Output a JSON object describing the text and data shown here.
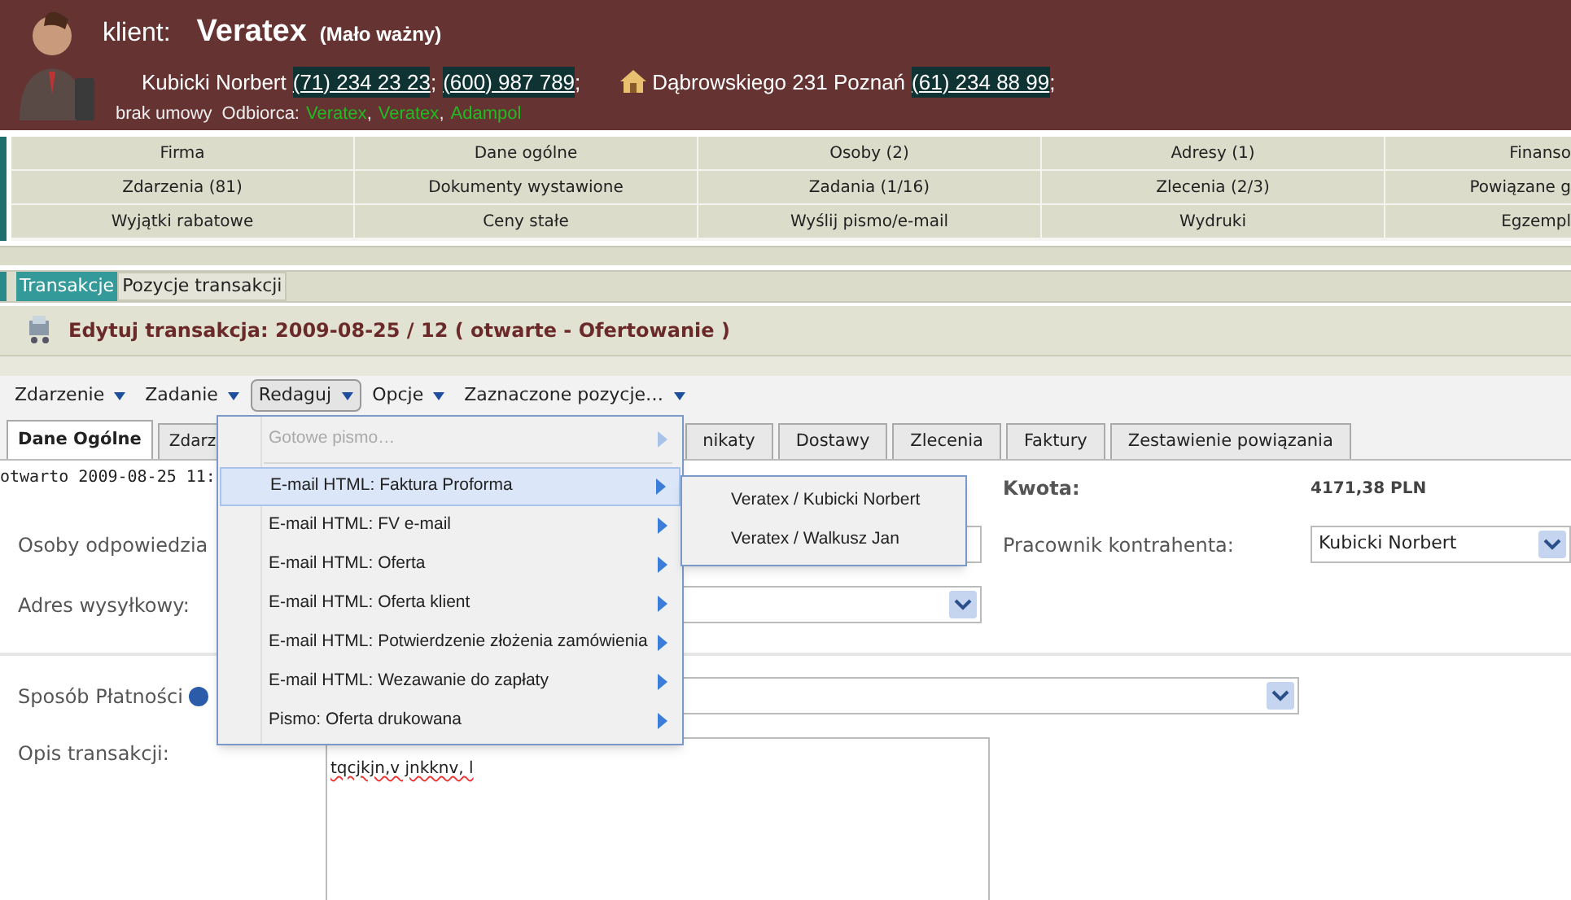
{
  "header": {
    "label": "klient:",
    "name": "Veratex",
    "priority": "(Mało ważny)",
    "person": "Kubicki Norbert",
    "phones": [
      "(71) 234 23 23",
      "(600) 987 789"
    ],
    "address": "Dąbrowskiego 231 Poznań",
    "address_phone": "(61) 234 88 99",
    "contract": "brak umowy",
    "recipient_label": "Odbiorca:",
    "recipients": [
      "Veratex",
      "Veratex",
      "Adampol"
    ],
    "phone_separator": ";",
    "recipient_separator": ","
  },
  "nav": [
    [
      "Firma",
      "Dane ogólne",
      "Osoby (2)",
      "Adresy (1)",
      "Finanso"
    ],
    [
      "Zdarzenia (81)",
      "Dokumenty wystawione",
      "Zadania (1/16)",
      "Zlecenia (2/3)",
      "Powiązane g"
    ],
    [
      "Wyjątki rabatowe",
      "Ceny stałe",
      "Wyślij pismo/e-mail",
      "Wydruki",
      "Egzempl"
    ]
  ],
  "subtabs": [
    {
      "label": "Transakcje",
      "selected": true
    },
    {
      "label": "Pozycje transakcji",
      "selected": false
    }
  ],
  "title": "Edytuj transakcja: 2009-08-25 / 12 ( otwarte - Ofertowanie )",
  "toolbar": [
    {
      "label": "Zdarzenie",
      "selected": false
    },
    {
      "label": "Zadanie",
      "selected": false
    },
    {
      "label": "Redaguj",
      "selected": true
    },
    {
      "label": "Opcje",
      "selected": false
    },
    {
      "label": "Zaznaczone pozycje…",
      "selected": false
    }
  ],
  "tabs": [
    {
      "label": "Dane Ogólne",
      "selected": true
    },
    {
      "label": "Zdarz",
      "selected": false
    },
    {
      "label": "nikaty",
      "selected": false
    },
    {
      "label": "Dostawy",
      "selected": false
    },
    {
      "label": "Zlecenia",
      "selected": false
    },
    {
      "label": "Faktury",
      "selected": false
    },
    {
      "label": "Zestawienie powiązania",
      "selected": false
    }
  ],
  "opened": "otwarto 2009-08-25 11:",
  "fields": {
    "responsible_label": "Osoby odpowiedzia",
    "shipping_label": "Adres wysyłkowy:",
    "amount_label": "Kwota:",
    "amount": "4171,38 PLN",
    "contact_label": "Pracownik kontrahenta:",
    "contact": "Kubicki Norbert",
    "payment_label": "Sposób Płatności",
    "description_label": "Opis transakcji:",
    "description": "tqcjkjn,v jnkknv, l"
  },
  "menu": [
    {
      "label": "Gotowe pismo…",
      "disabled": true,
      "selected": false
    },
    {
      "label": "E-mail HTML: Faktura Proforma",
      "disabled": false,
      "selected": true,
      "submenu": [
        "Veratex / Kubicki Norbert",
        "Veratex / Walkusz Jan"
      ]
    },
    {
      "label": "E-mail HTML: FV e-mail",
      "disabled": false,
      "selected": false
    },
    {
      "label": "E-mail HTML: Oferta",
      "disabled": false,
      "selected": false
    },
    {
      "label": "E-mail HTML: Oferta klient",
      "disabled": false,
      "selected": false
    },
    {
      "label": "E-mail HTML: Potwierdzenie złożenia zamówienia",
      "disabled": false,
      "selected": false
    },
    {
      "label": "E-mail HTML: Wezawanie do zapłaty",
      "disabled": false,
      "selected": false
    },
    {
      "label": "Pismo: Oferta drukowana",
      "disabled": false,
      "selected": false
    }
  ]
}
